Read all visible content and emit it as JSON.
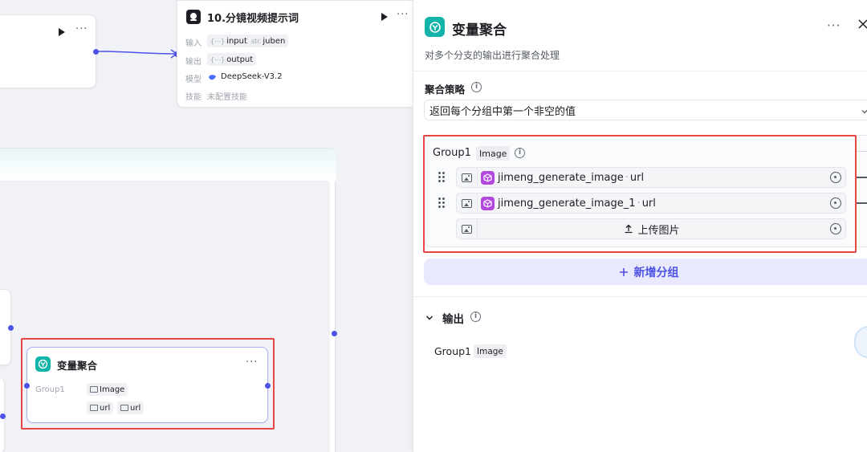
{
  "canvas": {
    "node_top_left": {},
    "node_storyboard": {
      "title": "10.分镜视频提示词",
      "input_label": "输入",
      "input_tag_prefix": "{⋯}",
      "input_tag": "input",
      "input_tag2_prefix": "str.",
      "input_tag2": "juben",
      "output_label": "输出",
      "output_tag_prefix": "{⋯}",
      "output_tag": "output",
      "model_label": "模型",
      "model_value": "DeepSeek-V3.2",
      "skill_label": "技能",
      "skill_value": "未配置技能"
    },
    "node_aggregate": {
      "title": "变量聚合",
      "group_label": "Group1",
      "type_tag": "Image",
      "ref1": "url",
      "ref2": "url"
    }
  },
  "panel": {
    "title": "变量聚合",
    "subtitle": "对多个分支的输出进行聚合处理",
    "strategy_label": "聚合策略",
    "strategy_value": "返回每个分组中第一个非空的值",
    "group": {
      "name": "Group1",
      "type": "Image",
      "rows": [
        {
          "node": "jimeng_generate_image",
          "sep": "·",
          "field": "url"
        },
        {
          "node": "jimeng_generate_image_1",
          "sep": "·",
          "field": "url"
        }
      ],
      "upload_label": "上传图片"
    },
    "add_group_label": "新增分组",
    "output_label": "输出",
    "output_group_name": "Group1",
    "output_group_type": "Image"
  },
  "colors": {
    "accent": "#4d53e8",
    "teal": "#12b3a8",
    "highlight": "#e84545",
    "plugin": "#b347e0"
  },
  "icons": [
    "play-icon",
    "more-icon",
    "close-icon",
    "info-icon",
    "chevron-down-icon",
    "drag-handle-icon",
    "image-icon",
    "plugin-cube-icon",
    "clear-icon",
    "upload-icon",
    "plus-icon",
    "aggregate-icon",
    "bot-icon",
    "deepseek-icon"
  ]
}
